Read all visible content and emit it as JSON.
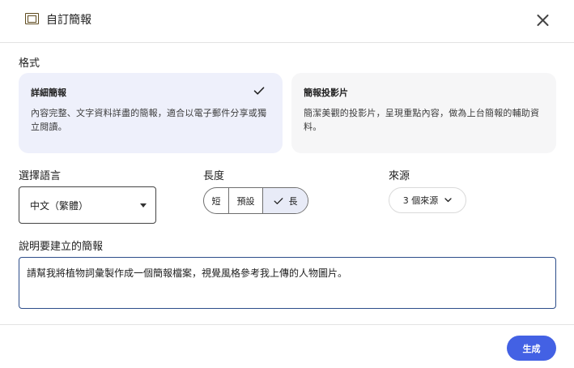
{
  "header": {
    "title": "自訂簡報",
    "icon": "slides-icon",
    "close_icon": "close-icon"
  },
  "format": {
    "label": "格式",
    "options": [
      {
        "title": "詳細簡報",
        "description": "內容完整、文字資料詳盡的簡報，適合以電子郵件分享或獨立閱讀。",
        "selected": true
      },
      {
        "title": "簡報投影片",
        "description": "簡潔美觀的投影片，呈現重點內容，做為上台簡報的輔助資料。",
        "selected": false
      }
    ]
  },
  "language": {
    "label": "選擇語言",
    "value": "中文（繁體）"
  },
  "length": {
    "label": "長度",
    "options": [
      "短",
      "預設",
      "長"
    ],
    "selected": "長"
  },
  "source": {
    "label": "來源",
    "button_label": "3 個來源"
  },
  "prompt": {
    "label": "說明要建立的簡報",
    "value": "請幫我將植物詞彙製作成一個簡報檔案，視覺風格參考我上傳的人物圖片。"
  },
  "actions": {
    "generate_label": "生成"
  },
  "colors": {
    "accent": "#4361e4",
    "selected_card": "#eef0fb",
    "input_border": "#2d4d8a"
  }
}
